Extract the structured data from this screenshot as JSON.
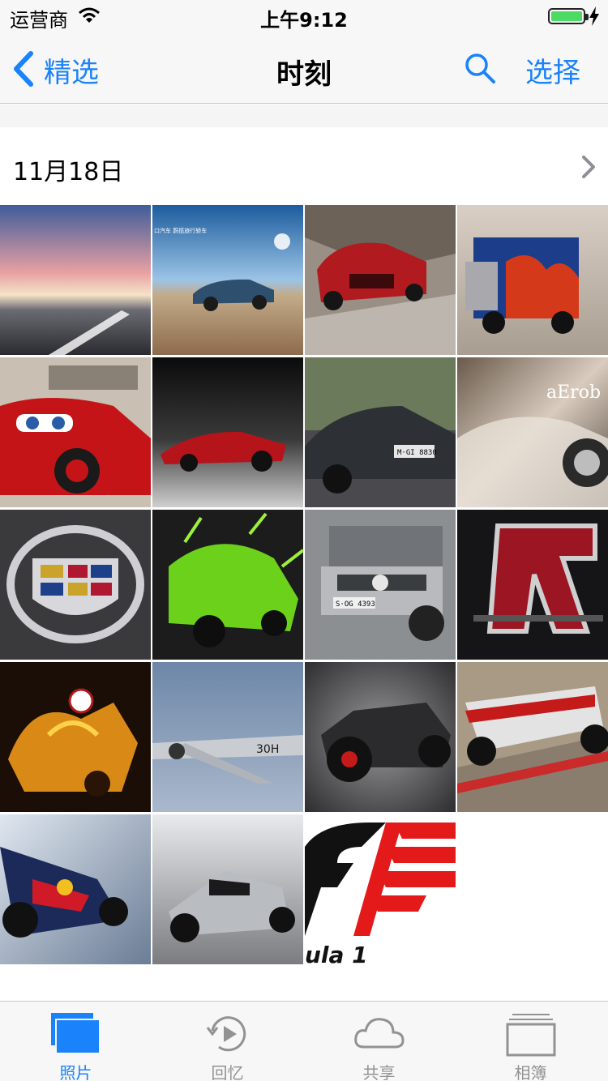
{
  "status_bar": {
    "carrier": "运营商",
    "time": "上午9:12"
  },
  "nav": {
    "back_label": "精选",
    "title": "时刻",
    "select_label": "选择"
  },
  "section": {
    "date": "11月18日"
  },
  "photos": [
    {
      "label": "sunset road"
    },
    {
      "label": "blue wagon ad",
      "text": "口汽车  蔚揽旅行轿车"
    },
    {
      "label": "red coupe mountain"
    },
    {
      "label": "flame truck"
    },
    {
      "label": "cartoon race car"
    },
    {
      "label": "red sports car studio"
    },
    {
      "label": "gray hybrid coupe",
      "text": "M·GI 8830"
    },
    {
      "label": "concept car art",
      "text": "aErob"
    },
    {
      "label": "crest emblem"
    },
    {
      "label": "green splash car"
    },
    {
      "label": "silver suv",
      "text": "S·OG 4393"
    },
    {
      "label": "red r logo"
    },
    {
      "label": "golden bull"
    },
    {
      "label": "bomber plane",
      "text": "30H"
    },
    {
      "label": "black concept car"
    },
    {
      "label": "f1 mclaren"
    },
    {
      "label": "f1 red bull"
    },
    {
      "label": "f1 mercedes"
    },
    {
      "label": "f1 logo",
      "text": "ula 1"
    }
  ],
  "tabs": [
    {
      "label": "照片",
      "icon": "photos-icon",
      "active": true
    },
    {
      "label": "回忆",
      "icon": "memories-icon",
      "active": false
    },
    {
      "label": "共享",
      "icon": "cloud-icon",
      "active": false
    },
    {
      "label": "相簿",
      "icon": "albums-icon",
      "active": false
    }
  ],
  "colors": {
    "accent": "#1a82fb",
    "inactive": "#929292",
    "battery": "#4cd964"
  }
}
